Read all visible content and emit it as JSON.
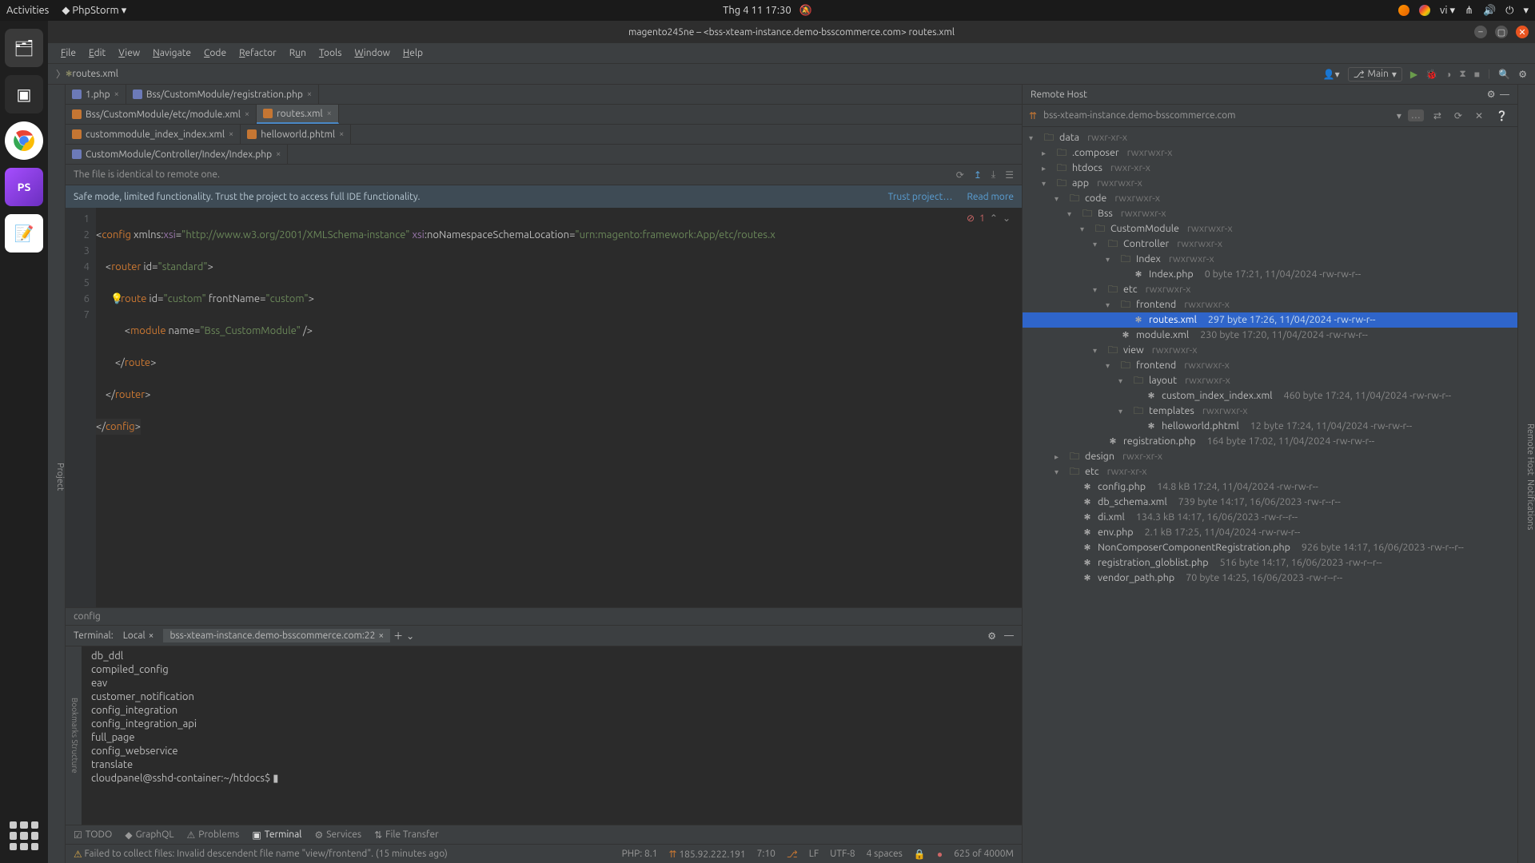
{
  "gnome": {
    "activities": "Activities",
    "app": "PhpStorm",
    "datetime": "Thg 4 11  17:30",
    "lang": "vi"
  },
  "window": {
    "title": "magento245ne – <bss-xteam-instance.demo-bsscommerce.com> routes.xml"
  },
  "menu": [
    "File",
    "Edit",
    "View",
    "Navigate",
    "Code",
    "Refactor",
    "Run",
    "Tools",
    "Window",
    "Help"
  ],
  "nav": {
    "crumb": "routes.xml",
    "branch": "Main"
  },
  "sidebar_left": "Project",
  "tabs": [
    [
      {
        "icon": "php",
        "label": "1.php"
      },
      {
        "icon": "php",
        "label": "<bss-xteam-instance.demo-bsscommerce.com> Bss/CustomModule/registration.php"
      }
    ],
    [
      {
        "icon": "xml",
        "label": "<bss-xteam-instance.demo-bsscommerce.com> Bss/CustomModule/etc/module.xml"
      },
      {
        "icon": "xml",
        "label": "<bss-xteam-instance.demo-bsscommerce.com> routes.xml",
        "active": true
      }
    ],
    [
      {
        "icon": "xml",
        "label": "<bss-xteam-instance.demo-bsscommerce.com> custommodule_index_index.xml"
      },
      {
        "icon": "html",
        "label": "<bss-xteam-instance.demo-bsscommerce.com> helloworld.phtml"
      }
    ],
    [
      {
        "icon": "php",
        "label": "<bss-xteam-instance.demo-bsscommerce.com> CustomModule/Controller/Index/Index.php"
      }
    ]
  ],
  "infobar": {
    "msg": "The file is identical to remote one."
  },
  "safebar": {
    "msg": "Safe mode, limited functionality. Trust the project to access full IDE functionality.",
    "trust": "Trust project…",
    "more": "Read more"
  },
  "code": {
    "lines": [
      "1",
      "2",
      "3",
      "4",
      "5",
      "6",
      "7"
    ],
    "err_count": "1",
    "content": {
      "l1a": "config",
      "l1b": "xmlns:",
      "l1c": "xsi",
      "l1d": "\"http://www.w3.org/2001/XMLSchema-instance\"",
      "l1e": "xsi",
      "l1f": ":noNamespaceSchemaLocation",
      "l1g": "\"urn:magento:framework:App/etc/routes.x",
      "l2a": "router",
      "l2b": "id",
      "l2c": "\"standard\"",
      "l3a": "route",
      "l3b": "id",
      "l3c": "\"custom\"",
      "l3d": "frontName",
      "l3e": "\"custom\"",
      "l4a": "module",
      "l4b": "name",
      "l4c": "\"Bss_CustomModule\"",
      "l5a": "route",
      "l6a": "router",
      "l7a": "config"
    }
  },
  "breadcrumb": "config",
  "terminal": {
    "title": "Terminal:",
    "tabs": [
      {
        "label": "Local"
      },
      {
        "label": "bss-xteam-instance.demo-bsscommerce.com:22",
        "active": true
      }
    ],
    "lines": [
      "db_ddl",
      "compiled_config",
      "eav",
      "customer_notification",
      "config_integration",
      "config_integration_api",
      "full_page",
      "config_webservice",
      "translate",
      "cloudpanel@sshd-container:~/htdocs$ ▮"
    ],
    "side1": "Bookmarks",
    "side2": "Structure"
  },
  "toolwindow": [
    {
      "icon": "☑",
      "label": "TODO"
    },
    {
      "icon": "◆",
      "label": "GraphQL"
    },
    {
      "icon": "⚠",
      "label": "Problems"
    },
    {
      "icon": "▣",
      "label": "Terminal",
      "active": true
    },
    {
      "icon": "⚙",
      "label": "Services"
    },
    {
      "icon": "⇅",
      "label": "File Transfer"
    }
  ],
  "status": {
    "msg": "Failed to collect files: Invalid descendent file name \"view/frontend\". (15 minutes ago)",
    "php": "PHP: 8.1",
    "ip": "185.92.222.191",
    "pos": "7:10",
    "lf": "LF",
    "enc": "UTF-8",
    "indent": "4 spaces",
    "mem": "625 of 4000M"
  },
  "remote": {
    "title": "Remote Host",
    "host": "bss-xteam-instance.demo-bsscommerce.com",
    "tree": [
      {
        "d": 0,
        "a": "▾",
        "t": "folder",
        "n": "data",
        "p": "rwxr-xr-x"
      },
      {
        "d": 1,
        "a": "▸",
        "t": "folder",
        "n": ".composer",
        "p": "rwxrwxr-x"
      },
      {
        "d": 1,
        "a": "▸",
        "t": "folder",
        "n": "htdocs",
        "p": "rwxr-xr-x"
      },
      {
        "d": 1,
        "a": "▾",
        "t": "folder",
        "n": "app",
        "p": "rwxrwxr-x"
      },
      {
        "d": 2,
        "a": "▾",
        "t": "folder",
        "n": "code",
        "p": "rwxrwxr-x"
      },
      {
        "d": 3,
        "a": "▾",
        "t": "folder",
        "n": "Bss",
        "p": "rwxrwxr-x"
      },
      {
        "d": 4,
        "a": "▾",
        "t": "folder",
        "n": "CustomModule",
        "p": "rwxrwxr-x"
      },
      {
        "d": 5,
        "a": "▾",
        "t": "folder",
        "n": "Controller",
        "p": "rwxrwxr-x"
      },
      {
        "d": 6,
        "a": "▾",
        "t": "folder",
        "n": "Index",
        "p": "rwxrwxr-x"
      },
      {
        "d": 7,
        "a": "",
        "t": "file",
        "n": "Index.php",
        "m": "0 byte   17:21, 11/04/2024   -rw-rw-r--"
      },
      {
        "d": 5,
        "a": "▾",
        "t": "folder",
        "n": "etc",
        "p": "rwxrwxr-x"
      },
      {
        "d": 6,
        "a": "▾",
        "t": "folder",
        "n": "frontend",
        "p": "rwxrwxr-x"
      },
      {
        "d": 7,
        "a": "",
        "t": "file",
        "n": "routes.xml",
        "m": "297 byte   17:26, 11/04/2024   -rw-rw-r--",
        "sel": true
      },
      {
        "d": 6,
        "a": "",
        "t": "file",
        "n": "module.xml",
        "m": "230 byte   17:20, 11/04/2024   -rw-rw-r--"
      },
      {
        "d": 5,
        "a": "▾",
        "t": "folder",
        "n": "view",
        "p": "rwxrwxr-x"
      },
      {
        "d": 6,
        "a": "▾",
        "t": "folder",
        "n": "frontend",
        "p": "rwxrwxr-x"
      },
      {
        "d": 7,
        "a": "▾",
        "t": "folder",
        "n": "layout",
        "p": "rwxrwxr-x"
      },
      {
        "d": 8,
        "a": "",
        "t": "file",
        "n": "custom_index_index.xml",
        "m": "460 byte   17:24, 11/04/2024   -rw-rw-r--"
      },
      {
        "d": 7,
        "a": "▾",
        "t": "folder",
        "n": "templates",
        "p": "rwxrwxr-x"
      },
      {
        "d": 8,
        "a": "",
        "t": "file",
        "n": "helloworld.phtml",
        "m": "12 byte   17:24, 11/04/2024   -rw-rw-r--"
      },
      {
        "d": 5,
        "a": "",
        "t": "file",
        "n": "registration.php",
        "m": "164 byte   17:02, 11/04/2024   -rw-rw-r--"
      },
      {
        "d": 2,
        "a": "▸",
        "t": "folder",
        "n": "design",
        "p": "rwxr-xr-x"
      },
      {
        "d": 2,
        "a": "▾",
        "t": "folder",
        "n": "etc",
        "p": "rwxr-xr-x"
      },
      {
        "d": 3,
        "a": "",
        "t": "file",
        "n": "config.php",
        "m": "14.8 kB   17:24, 11/04/2024   -rw-rw-r--"
      },
      {
        "d": 3,
        "a": "",
        "t": "file",
        "n": "db_schema.xml",
        "m": "739 byte   14:17, 16/06/2023   -rw-r--r--"
      },
      {
        "d": 3,
        "a": "",
        "t": "file",
        "n": "di.xml",
        "m": "134.3 kB   14:17, 16/06/2023   -rw-r--r--"
      },
      {
        "d": 3,
        "a": "",
        "t": "file",
        "n": "env.php",
        "m": "2.1 kB   17:25, 11/04/2024   -rw-rw-r--"
      },
      {
        "d": 3,
        "a": "",
        "t": "file",
        "n": "NonComposerComponentRegistration.php",
        "m": "926 byte   14:17, 16/06/2023   -rw-r--r--"
      },
      {
        "d": 3,
        "a": "",
        "t": "file",
        "n": "registration_globlist.php",
        "m": "516 byte   14:17, 16/06/2023   -rw-r--r--"
      },
      {
        "d": 3,
        "a": "",
        "t": "file",
        "n": "vendor_path.php",
        "m": "70 byte   14:25, 16/06/2023   -rw-r--r--"
      }
    ]
  },
  "sidebar_right": [
    "Remote Host",
    "Notifications"
  ]
}
